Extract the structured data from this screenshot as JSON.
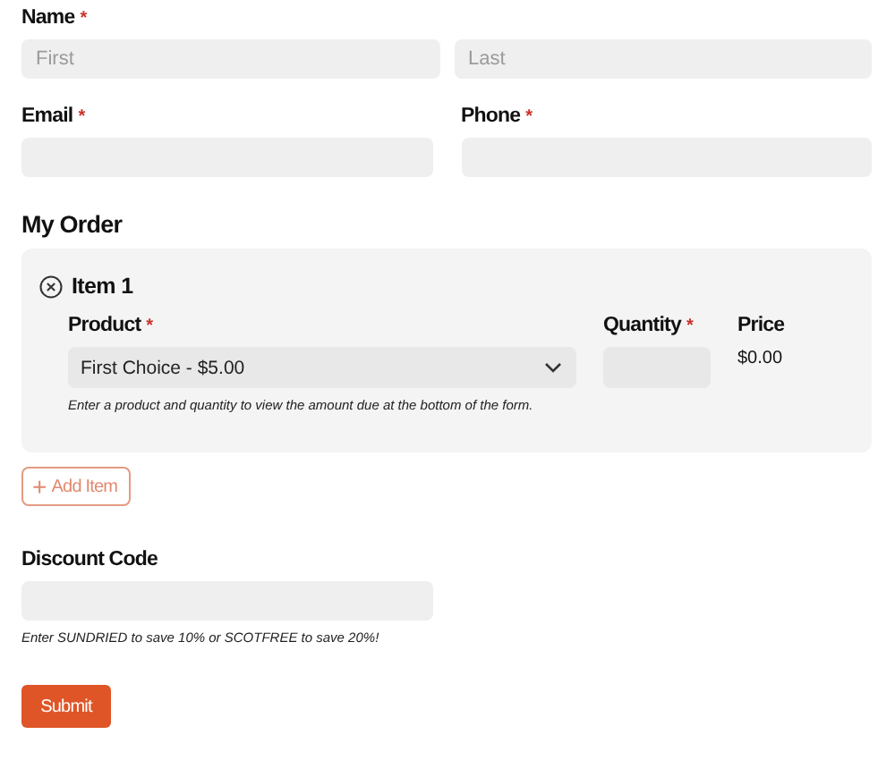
{
  "name": {
    "label": "Name",
    "required_mark": "*",
    "fields": [
      {
        "placeholder": "First"
      },
      {
        "placeholder": "Last"
      }
    ]
  },
  "contact": [
    {
      "label": "Email",
      "required_mark": "*"
    },
    {
      "label": "Phone",
      "required_mark": "*"
    }
  ],
  "order": {
    "heading": "My Order",
    "items": [
      {
        "title": "Item 1",
        "product": {
          "label": "Product",
          "required_mark": "*",
          "value": "First Choice - $5.00"
        },
        "quantity": {
          "label": "Quantity",
          "required_mark": "*"
        },
        "price": {
          "label": "Price",
          "value": "$0.00"
        },
        "help": "Enter a product and quantity to view the amount due at the bottom of the form."
      }
    ],
    "add_button": {
      "icon": "+",
      "label": "Add Item"
    }
  },
  "discount": {
    "label": "Discount Code",
    "help": "Enter SUNDRIED to save 10% or SCOTFREE to save 20%!"
  },
  "submit": "Submit"
}
